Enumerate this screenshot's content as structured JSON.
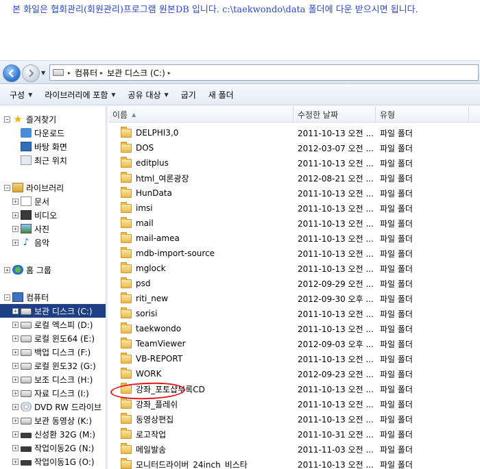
{
  "notice": "본 화일은 협회관리(회원관리)프로그램 원본DB 입니다. c:\\taekwondo\\data 폴더에 다운 받으시면 됩니다.",
  "address": {
    "crumbs": [
      "컴퓨터",
      "보관 디스크 (C:)"
    ]
  },
  "toolbar": {
    "organize": "구성",
    "include_library": "라이브러리에 포함",
    "share_with": "공유 대상",
    "burn": "굽기",
    "new_folder": "새 폴더"
  },
  "nav": {
    "favorites": "즐겨찾기",
    "downloads": "다운로드",
    "desktop": "바탕 화면",
    "recent": "최근 위치",
    "libraries": "라이브러리",
    "documents": "문서",
    "videos": "비디오",
    "pictures": "사진",
    "music": "음악",
    "homegroup": "홈 그룹",
    "computer": "컴퓨터",
    "drives": [
      {
        "label": "보관 디스크 (C:)",
        "icon": "drive",
        "selected": true
      },
      {
        "label": "로컬 엑스피 (D:)",
        "icon": "drive"
      },
      {
        "label": "로컬 윈도64 (E:)",
        "icon": "drive"
      },
      {
        "label": "백업 디스크 (F:)",
        "icon": "drive"
      },
      {
        "label": "로컬 윈도32 (G:)",
        "icon": "drive"
      },
      {
        "label": "보조 디스크 (H:)",
        "icon": "drive"
      },
      {
        "label": "자료 디스크 (I:)",
        "icon": "drive"
      },
      {
        "label": "DVD RW 드라이브",
        "icon": "dvd"
      },
      {
        "label": "보관 동영상 (K:)",
        "icon": "drive"
      },
      {
        "label": "신성환 32G (M:)",
        "icon": "usb"
      },
      {
        "label": "작업이동2G (N:)",
        "icon": "usb"
      },
      {
        "label": "작업이동1G (O:)",
        "icon": "usb"
      }
    ]
  },
  "columns": {
    "name": "이름",
    "date": "수정한 날짜",
    "type": "유형"
  },
  "files": [
    {
      "name": "DELPHI3,0",
      "date": "2011-10-13 오전 ...",
      "type": "파일 폴더"
    },
    {
      "name": "DOS",
      "date": "2012-03-07 오전 ...",
      "type": "파일 폴더"
    },
    {
      "name": "editplus",
      "date": "2011-10-13 오전 ...",
      "type": "파일 폴더"
    },
    {
      "name": "html_여론광장",
      "date": "2012-08-21 오전 ...",
      "type": "파일 폴더"
    },
    {
      "name": "HunData",
      "date": "2011-10-13 오전 ...",
      "type": "파일 폴더"
    },
    {
      "name": "imsi",
      "date": "2011-10-13 오전 ...",
      "type": "파일 폴더"
    },
    {
      "name": "mail",
      "date": "2011-10-13 오전 ...",
      "type": "파일 폴더"
    },
    {
      "name": "mail-amea",
      "date": "2011-10-13 오전 ...",
      "type": "파일 폴더"
    },
    {
      "name": "mdb-import-source",
      "date": "2011-10-13 오전 ...",
      "type": "파일 폴더"
    },
    {
      "name": "mglock",
      "date": "2011-10-13 오전 ...",
      "type": "파일 폴더"
    },
    {
      "name": "psd",
      "date": "2012-09-29 오전 ...",
      "type": "파일 폴더"
    },
    {
      "name": "riti_new",
      "date": "2012-09-30 오후 ...",
      "type": "파일 폴더"
    },
    {
      "name": "sorisi",
      "date": "2011-10-13 오전 ...",
      "type": "파일 폴더"
    },
    {
      "name": "taekwondo",
      "date": "2011-10-13 오전 ...",
      "type": "파일 폴더"
    },
    {
      "name": "TeamViewer",
      "date": "2012-09-03 오후 ...",
      "type": "파일 폴더"
    },
    {
      "name": "VB-REPORT",
      "date": "2011-10-13 오전 ...",
      "type": "파일 폴더"
    },
    {
      "name": "WORK",
      "date": "2012-09-23 오전 ...",
      "type": "파일 폴더"
    },
    {
      "name": "강좌_포토샵부록CD",
      "date": "2011-10-13 오전 ...",
      "type": "파일 폴더"
    },
    {
      "name": "강좌_플레쉬",
      "date": "2011-10-13 오전 ...",
      "type": "파일 폴더"
    },
    {
      "name": "동영상편집",
      "date": "2011-10-13 오전 ...",
      "type": "파일 폴더"
    },
    {
      "name": "로고작업",
      "date": "2011-10-31 오전 ...",
      "type": "파일 폴더"
    },
    {
      "name": "메일발송",
      "date": "2011-11-03 오전 ...",
      "type": "파일 폴더"
    },
    {
      "name": "모니터드라이버_24inch_비스타",
      "date": "2011-10-13 오전 ...",
      "type": "파일 폴더"
    }
  ],
  "highlight_color": "#e8141a"
}
